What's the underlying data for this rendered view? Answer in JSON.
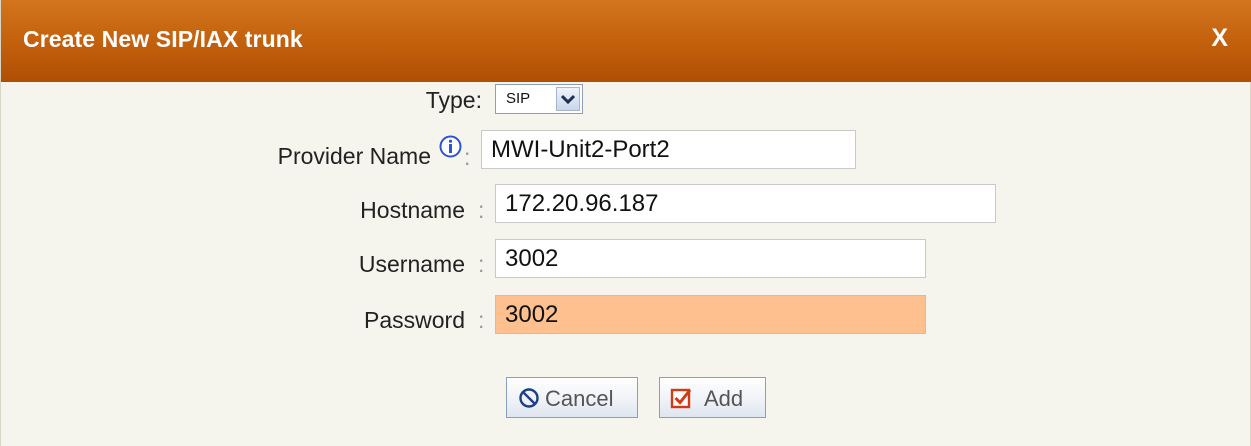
{
  "dialog": {
    "title": "Create New SIP/IAX trunk",
    "close_label": "X"
  },
  "form": {
    "type": {
      "label": "Type:",
      "value": "SIP"
    },
    "provider_name": {
      "label": "Provider Name",
      "colon": ":",
      "value": "MWI-Unit2-Port2"
    },
    "hostname": {
      "label": "Hostname",
      "colon": ":",
      "value": "172.20.96.187"
    },
    "username": {
      "label": "Username",
      "colon": ":",
      "value": "3002"
    },
    "password": {
      "label": "Password",
      "colon": ":",
      "value": "3002"
    }
  },
  "buttons": {
    "cancel": "Cancel",
    "add": "Add"
  },
  "colors": {
    "title_bar": "#c25f0c",
    "focused_field": "#fec08e",
    "info_icon": "#2c55d6",
    "add_icon": "#d23a14"
  },
  "icons": {
    "info": "info-icon",
    "cancel": "cancel-circle-icon",
    "add": "checkbox-check-icon",
    "dropdown": "chevron-down-icon"
  }
}
